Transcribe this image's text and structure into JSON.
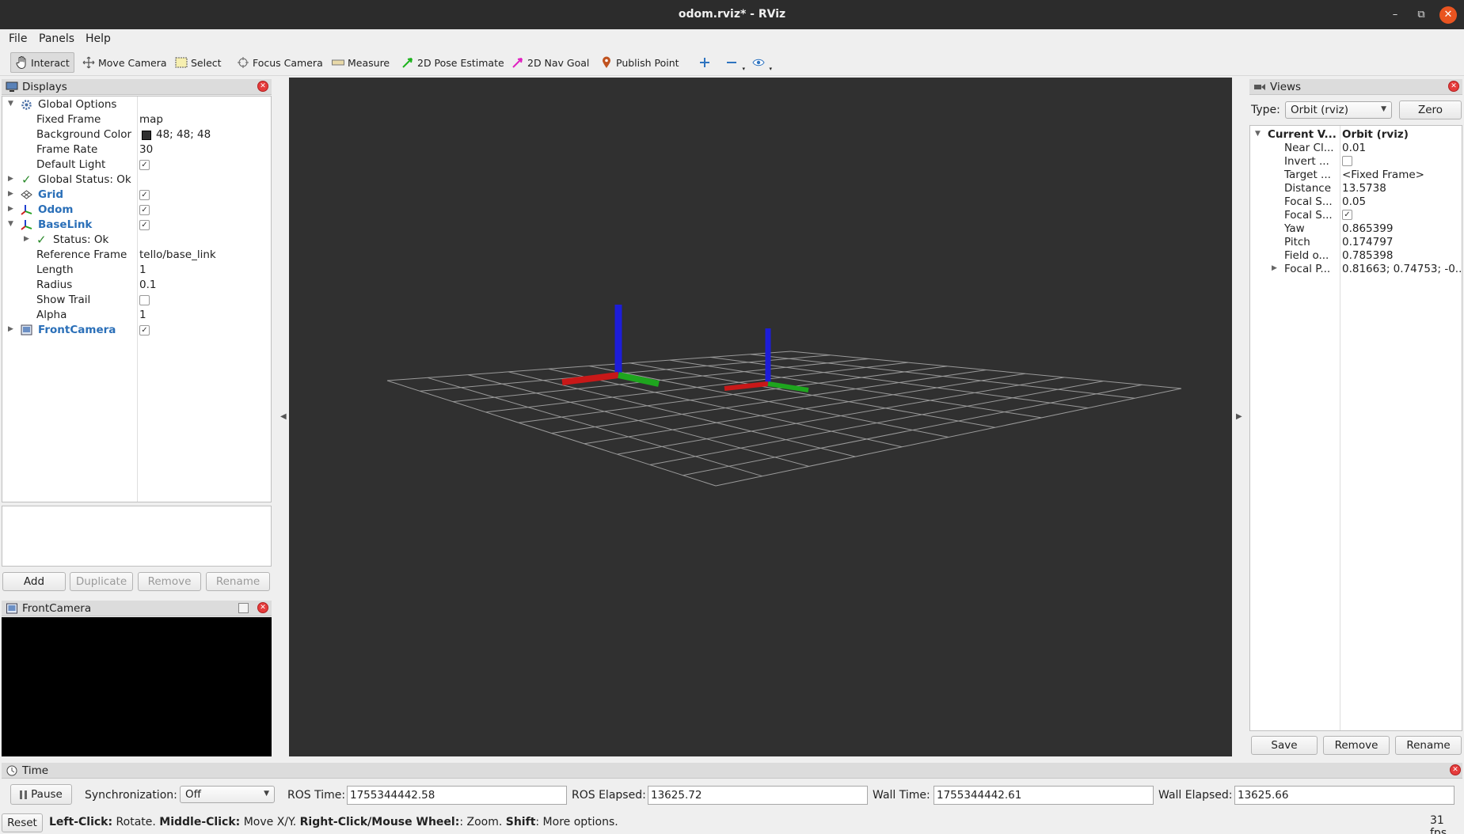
{
  "window": {
    "title": "odom.rviz* - RViz"
  },
  "menu": [
    "File",
    "Panels",
    "Help"
  ],
  "toolbar": {
    "interact": "Interact",
    "move_camera": "Move Camera",
    "select": "Select",
    "focus_camera": "Focus Camera",
    "measure": "Measure",
    "pose_estimate": "2D Pose Estimate",
    "nav_goal": "2D Nav Goal",
    "publish_point": "Publish Point"
  },
  "displays": {
    "title": "Displays",
    "rows": {
      "global_options": "Global Options",
      "fixed_frame_label": "Fixed Frame",
      "fixed_frame": "map",
      "bg_color_label": "Background Color",
      "bg_color": "48; 48; 48",
      "frame_rate_label": "Frame Rate",
      "frame_rate": "30",
      "default_light_label": "Default Light",
      "global_status": "Global Status: Ok",
      "grid": "Grid",
      "odom": "Odom",
      "baselink": "BaseLink",
      "status_ok": "Status: Ok",
      "ref_frame_label": "Reference Frame",
      "ref_frame": "tello/base_link",
      "length_label": "Length",
      "length": "1",
      "radius_label": "Radius",
      "radius": "0.1",
      "show_trail_label": "Show Trail",
      "alpha_label": "Alpha",
      "alpha": "1",
      "front_camera": "FrontCamera"
    },
    "buttons": {
      "add": "Add",
      "duplicate": "Duplicate",
      "remove": "Remove",
      "rename": "Rename"
    }
  },
  "front_camera": {
    "title": "FrontCamera"
  },
  "views": {
    "title": "Views",
    "type_label": "Type:",
    "type_value": "Orbit (rviz)",
    "zero": "Zero",
    "rows": {
      "current_label": "Current V...",
      "current_value": "Orbit (rviz)",
      "near_label": "Near Cl...",
      "near_value": "0.01",
      "invert_label": "Invert ...",
      "target_label": "Target ...",
      "target_value": "<Fixed Frame>",
      "distance_label": "Distance",
      "distance_value": "13.5738",
      "focal_size_label": "Focal S...",
      "focal_size_value": "0.05",
      "focal_shape_label": "Focal S...",
      "yaw_label": "Yaw",
      "yaw_value": "0.865399",
      "pitch_label": "Pitch",
      "pitch_value": "0.174797",
      "field_label": "Field o...",
      "field_value": "0.785398",
      "focal_point_label": "Focal P...",
      "focal_point_value": "0.81663; 0.74753; -0..."
    },
    "buttons": {
      "save": "Save",
      "remove": "Remove",
      "rename": "Rename"
    }
  },
  "time": {
    "title": "Time",
    "pause": "Pause",
    "sync_label": "Synchronization:",
    "sync_value": "Off",
    "ros_time_label": "ROS Time:",
    "ros_time": "1755344442.58",
    "ros_elapsed_label": "ROS Elapsed:",
    "ros_elapsed": "13625.72",
    "wall_time_label": "Wall Time:",
    "wall_time": "1755344442.61",
    "wall_elapsed_label": "Wall Elapsed:",
    "wall_elapsed": "13625.66"
  },
  "statusbar": {
    "reset": "Reset",
    "left_click": "Left-Click:",
    "left_click_desc": " Rotate. ",
    "middle_click": "Middle-Click:",
    "middle_click_desc": " Move X/Y. ",
    "right_click": "Right-Click/Mouse Wheel:",
    "right_click_desc": ": Zoom. ",
    "shift": "Shift",
    "shift_desc": ": More options.",
    "fps": "31 fps"
  },
  "colors": {
    "viewport_bg": "#303030",
    "accent_blue": "#2a6fb8",
    "close_orange": "#e95420"
  }
}
